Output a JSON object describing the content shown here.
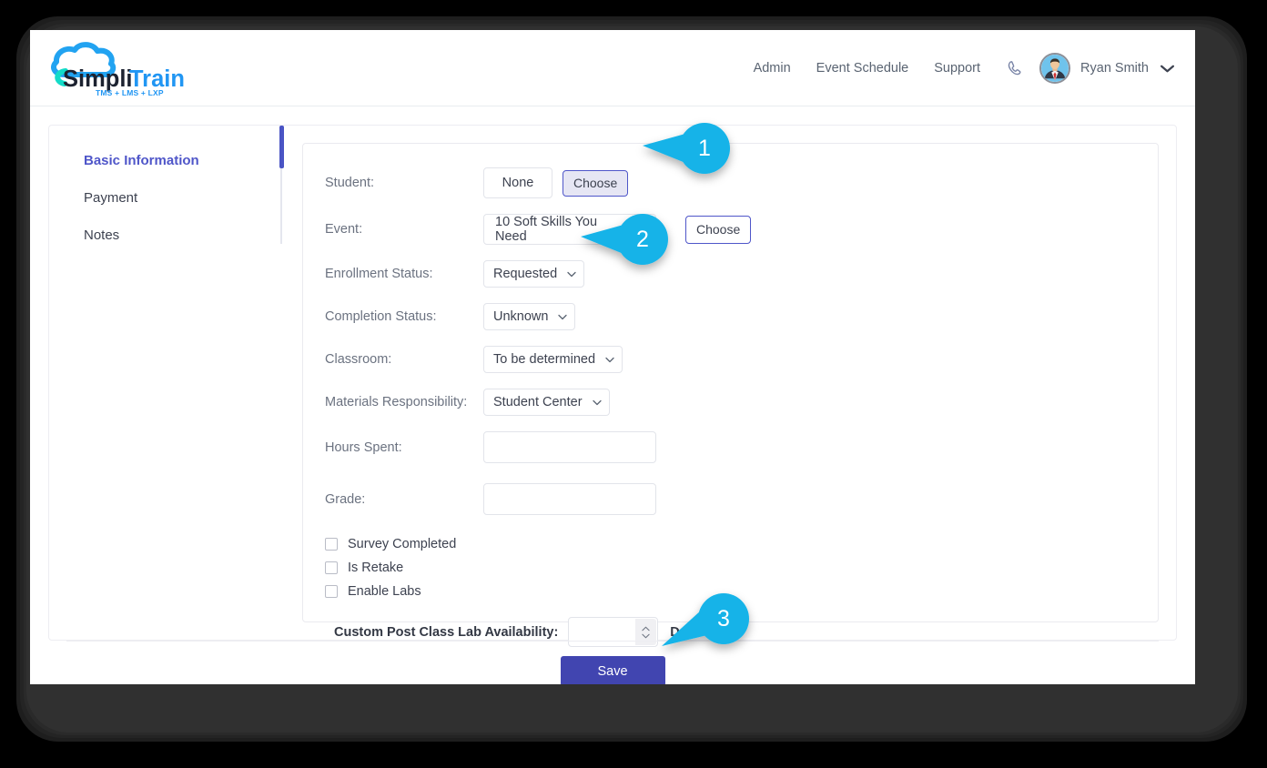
{
  "brand": {
    "name_part1": "Simpli",
    "name_part2": "Train",
    "tagline": "TMS + LMS + LXP",
    "cloud_color": "#22a3f1",
    "accent_color": "#2196f3",
    "dark_text_color": "#1c2230"
  },
  "header": {
    "nav_links": [
      {
        "label": "Admin",
        "name": "nav-admin"
      },
      {
        "label": "Event Schedule",
        "name": "nav-event-schedule"
      },
      {
        "label": "Support",
        "name": "nav-support"
      }
    ],
    "phone_icon": "phone-icon",
    "avatar_icon": "user-avatar",
    "user_name": "Ryan Smith",
    "caret_icon": "chevron-down-icon"
  },
  "sidebar": {
    "items": [
      {
        "label": "Basic Information",
        "active": true
      },
      {
        "label": "Payment",
        "active": false
      },
      {
        "label": "Notes",
        "active": false
      }
    ],
    "active_indicator_color": "#4a54c4",
    "active_text_color": "#4f56c9"
  },
  "form": {
    "student": {
      "label": "Student:",
      "value": "None",
      "choose_label": "Choose",
      "choose_focused": true
    },
    "event": {
      "label": "Event:",
      "value": "10 Soft Skills You Need",
      "clear_icon": "clear-circle-icon",
      "clear_color": "#e04f5f",
      "choose_label": "Choose",
      "choose_focused": false
    },
    "enrollment_status": {
      "label": "Enrollment Status:",
      "value": "Requested"
    },
    "completion_status": {
      "label": "Completion Status:",
      "value": "Unknown"
    },
    "classroom": {
      "label": "Classroom:",
      "value": "To be determined"
    },
    "materials_responsibility": {
      "label": "Materials Responsibility:",
      "value": "Student Center"
    },
    "hours_spent": {
      "label": "Hours Spent:",
      "value": "",
      "placeholder": ""
    },
    "grade": {
      "label": "Grade:",
      "value": "",
      "placeholder": ""
    },
    "checkboxes": [
      {
        "label": "Survey Completed",
        "checked": false
      },
      {
        "label": "Is Retake",
        "checked": false
      },
      {
        "label": "Enable Labs",
        "checked": false
      }
    ],
    "lab_availability": {
      "label": "Custom Post Class Lab Availability:",
      "value": "",
      "unit": "Days",
      "spinner_icon": "spinner-up-down-icon"
    }
  },
  "footer": {
    "save_label": "Save",
    "save_color": "#4145b0"
  },
  "callouts": [
    {
      "number": "1",
      "color": "#14b3e8"
    },
    {
      "number": "2",
      "color": "#14b3e8"
    },
    {
      "number": "3",
      "color": "#14b3e8"
    }
  ]
}
